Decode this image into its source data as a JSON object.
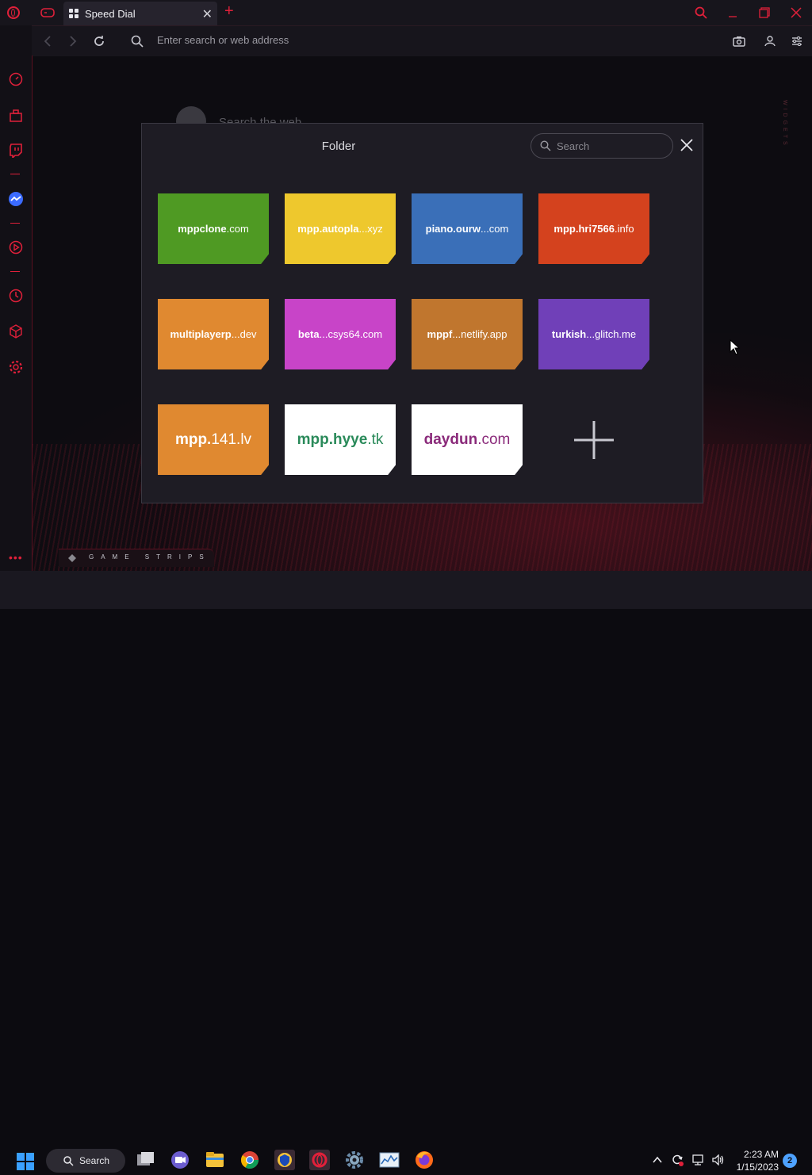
{
  "tabbar": {
    "tab_title": "Speed Dial"
  },
  "addressbar": {
    "placeholder": "Enter search or web address"
  },
  "background": {
    "search_faded": "Search the web",
    "widgets_label": "WIDGETS",
    "game_strips": "GAME STRIPS"
  },
  "folder": {
    "title": "Folder",
    "search_placeholder": "Search",
    "tiles": [
      {
        "label_bold": "mppclone",
        "label_rest": ".com",
        "color": "#4f9a23",
        "text_color": "#ffffff"
      },
      {
        "label_bold": "mpp.autopla",
        "label_rest": "...xyz",
        "color": "#eec82d",
        "text_color": "#ffffff"
      },
      {
        "label_bold": "piano.ourw",
        "label_rest": "...com",
        "color": "#3a6fb8",
        "text_color": "#ffffff"
      },
      {
        "label_bold": "mpp.hri7566",
        "label_rest": ".info",
        "color": "#d4421e",
        "text_color": "#ffffff"
      },
      {
        "label_bold": "multiplayerp",
        "label_rest": "...dev",
        "color": "#e08930",
        "text_color": "#ffffff"
      },
      {
        "label_bold": "beta",
        "label_rest": "...csys64.com",
        "color": "#c844c8",
        "text_color": "#ffffff"
      },
      {
        "label_bold": "mppf",
        "label_rest": "...netlify.app",
        "color": "#c0762e",
        "text_color": "#ffffff"
      },
      {
        "label_bold": "turkish",
        "label_rest": "...glitch.me",
        "color": "#7040b8",
        "text_color": "#ffffff"
      },
      {
        "label_bold": "mpp.",
        "label_rest": "141.lv",
        "color": "#e08930",
        "text_color": "#ffffff",
        "big": true
      },
      {
        "label_bold": "mpp.hyye",
        "label_rest": ".tk",
        "color": "#ffffff",
        "text_color": "#2a8a5a",
        "big": true
      },
      {
        "label_bold": "daydun",
        "label_rest": ".com",
        "color": "#ffffff",
        "text_color": "#8a2a7a",
        "big": true
      }
    ]
  },
  "taskbar": {
    "search_label": "Search",
    "time": "2:23 AM",
    "date": "1/15/2023",
    "notifications": "2"
  }
}
